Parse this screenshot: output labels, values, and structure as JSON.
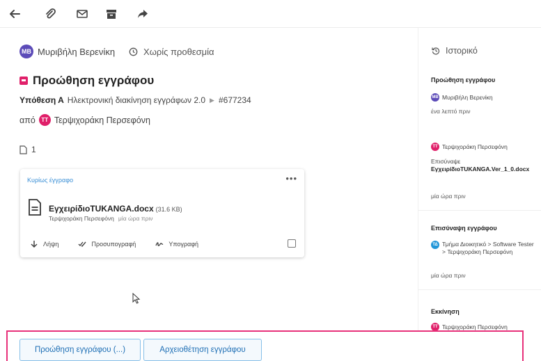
{
  "toolbar": {
    "icons": [
      "back-arrow-icon",
      "paperclip-icon",
      "envelope-icon",
      "archive-icon",
      "share-forward-icon"
    ]
  },
  "assignee": {
    "initials": "MB",
    "name": "Μυριβήλη Βερενίκη",
    "deadline": "Χωρίς προθεσμία"
  },
  "task": {
    "title": "Προώθηση εγγράφου",
    "subject_label": "Υπόθεση Α",
    "process": "Ηλεκτρονική διακίνηση εγγράφων 2.0",
    "ref": "#677234",
    "from_label": "από",
    "from_initials": "TT",
    "from_name": "Τερψιχοράκη Περσεφόνη",
    "attachment_count": "1"
  },
  "document": {
    "card_label": "Κυρίως έγγραφο",
    "menu": "•••",
    "file_name": "ΕγχειρίδιοTUKANGA.docx",
    "file_size": "(31.6 KB)",
    "uploader": "Τερψιχοράκη Περσεφόνη",
    "uploaded": "μία ώρα πριν",
    "actions": {
      "download": "Λήψη",
      "presign": "Προσυπογραφή",
      "sign": "Υπογραφή"
    }
  },
  "history": {
    "header": "Ιστορικό",
    "entries": [
      {
        "title": "Προώθηση εγγράφου",
        "user_initials": "MB",
        "user": "Μυριβήλη Βερενίκη",
        "time": "ένα λεπτό πριν"
      },
      {
        "user_initials": "TT",
        "user": "Τερψιχοράκη Περσεφόνη",
        "text_prefix": "Επισύναψε",
        "file": "ΕγχειρίδιοTUKANGA.Ver_1_0.docx",
        "time": "μία ώρα πριν"
      },
      {
        "title": "Επισύναψη εγγράφου",
        "user_initials": "ΤΔ",
        "path": "Τμήμα Διοικητικό > Software Tester > Τερψιχοράκη Περσεφόνη",
        "time": "μία ώρα πριν"
      },
      {
        "title": "Εκκίνηση",
        "user_initials": "TT",
        "user": "Τερψιχοράκη Περσεφόνη"
      }
    ]
  },
  "footer": {
    "forward_button": "Προώθηση εγγράφου (...)",
    "archive_button": "Αρχειοθέτηση εγγράφου"
  },
  "colors": {
    "accent_pink": "#e0206a",
    "avatar_purple": "#5c4bb8",
    "avatar_blue": "#2196d8",
    "button_blue": "#1e6fb5",
    "highlight_frame": "#e8307a"
  }
}
